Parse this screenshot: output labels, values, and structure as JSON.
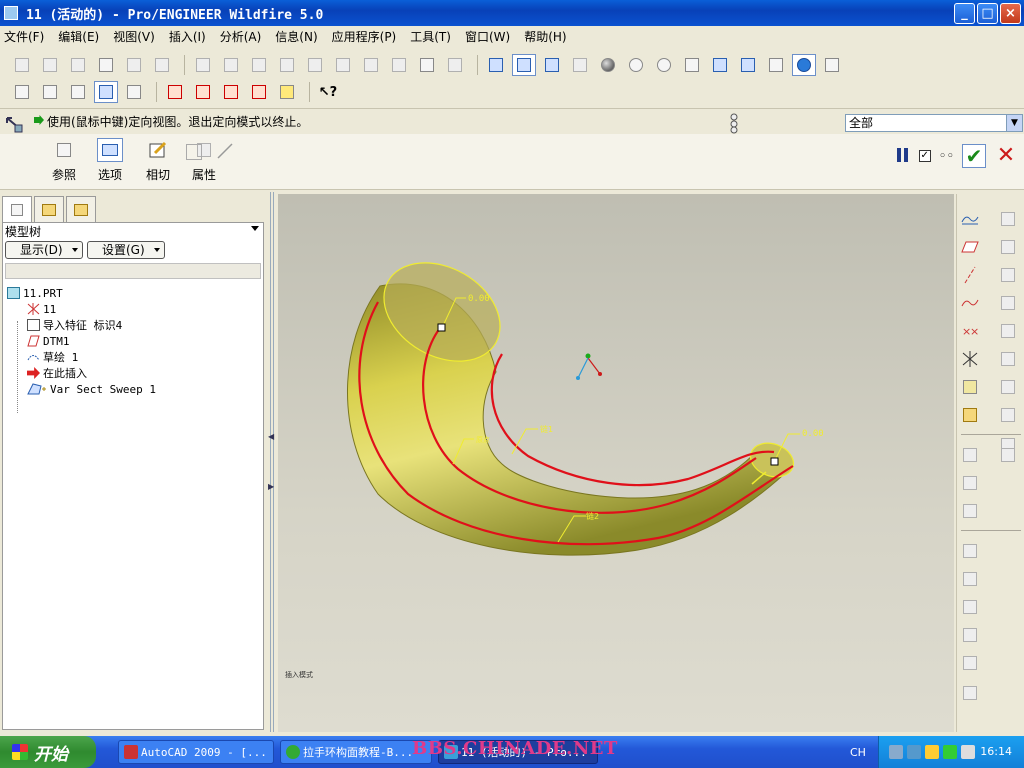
{
  "window": {
    "title": "11 (活动的) - Pro/ENGINEER Wildfire 5.0",
    "min": "_",
    "max": "□",
    "close": "×"
  },
  "menu": [
    "文件(F)",
    "编辑(E)",
    "视图(V)",
    "插入(I)",
    "分析(A)",
    "信息(N)",
    "应用程序(P)",
    "工具(T)",
    "窗口(W)",
    "帮助(H)"
  ],
  "message": {
    "text": "使用(鼠标中键)定向视图。退出定向模式以终止。",
    "filter_value": "全部"
  },
  "dashboard": {
    "tabs": [
      "参照",
      "选项",
      "相切",
      "属性"
    ],
    "active_tab": "选项"
  },
  "model_tree": {
    "header": "模型树",
    "show_button": "显示(D)",
    "settings_button": "设置(G)",
    "items": [
      {
        "label": "11.PRT",
        "icon": "part-icon"
      },
      {
        "label": "11",
        "icon": "csys-icon"
      },
      {
        "label": "导入特征 标识4",
        "icon": "import-feature-icon"
      },
      {
        "label": "DTM1",
        "icon": "datum-plane-icon"
      },
      {
        "label": "草绘 1",
        "icon": "sketch-icon"
      },
      {
        "label": "在此插入",
        "icon": "insert-here-arrow-icon"
      },
      {
        "label": "Var Sect Sweep 1",
        "icon": "var-sect-sweep-icon"
      }
    ]
  },
  "viewport": {
    "dim_top": "0.00",
    "dim_end": "0.00",
    "label_1": "原点",
    "label_2": "链1",
    "label_3": "链2",
    "caption": "插入模式"
  },
  "taskbar": {
    "start": "开始",
    "items": [
      "AutoCAD 2009 - [...",
      "拉手环构面教程-B...",
      "11 (活动的) - Pro..."
    ],
    "watermark": "BBS.CHINADE.NET",
    "lang": "CH",
    "clock": "16:14"
  },
  "colors": {
    "surface": "#d8cc4a",
    "trajectory": "#e0101a",
    "titlebar": "#0a52d0",
    "accept_check": "#1a8a1a",
    "cancel_x": "#cc1a1a"
  }
}
